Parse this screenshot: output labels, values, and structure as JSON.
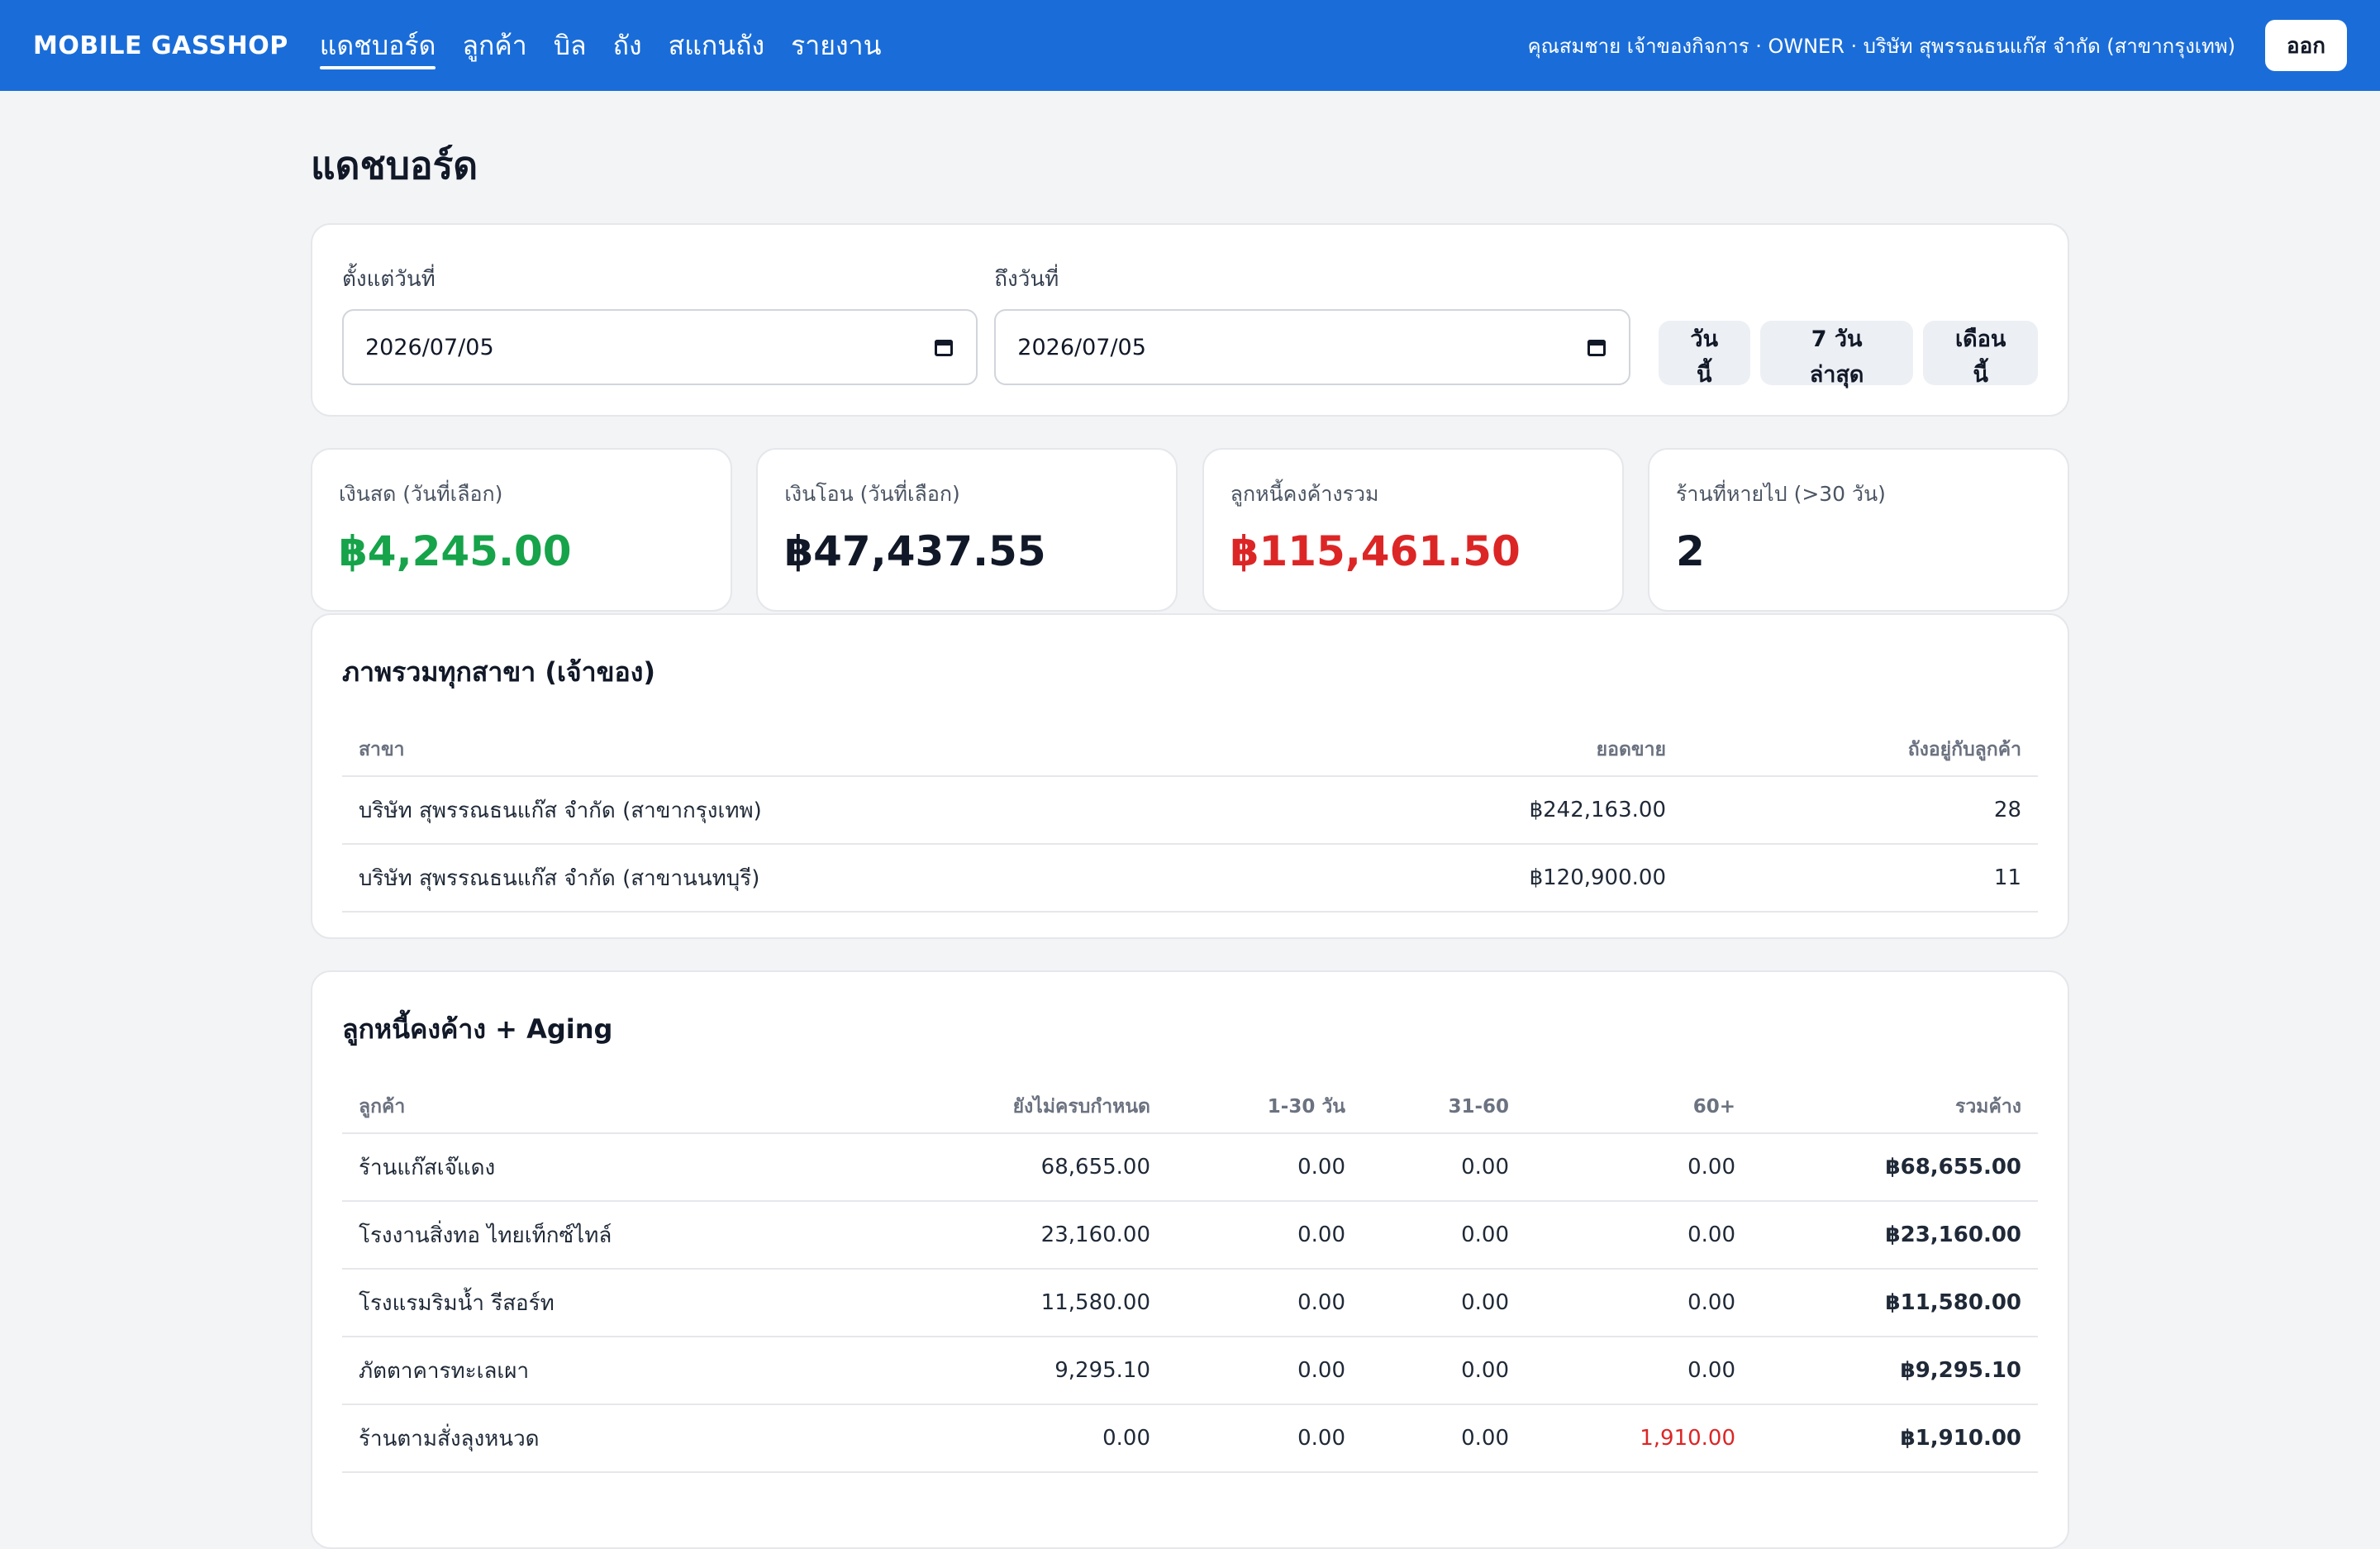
{
  "nav": {
    "brand": "MOBILE GASSHOP",
    "items": [
      {
        "label": "แดชบอร์ด",
        "active": true
      },
      {
        "label": "ลูกค้า"
      },
      {
        "label": "บิล"
      },
      {
        "label": "ถัง"
      },
      {
        "label": "สแกนถัง"
      },
      {
        "label": "รายงาน"
      }
    ],
    "user_info": "คุณสมชาย เจ้าของกิจการ · OWNER · บริษัท สุพรรณธนแก๊ส จำกัด (สาขากรุงเทพ)",
    "logout_label": "ออก"
  },
  "page_title": "แดชบอร์ด",
  "filter": {
    "from_label": "ตั้งแต่วันที่",
    "from_value": "2026/07/05",
    "to_label": "ถึงวันที่",
    "to_value": "2026/07/05",
    "quick": [
      "วันนี้",
      "7 วันล่าสุด",
      "เดือนนี้"
    ]
  },
  "stats": [
    {
      "label": "เงินสด (วันที่เลือก)",
      "value": "฿4,245.00",
      "color": "#16a34a"
    },
    {
      "label": "เงินโอน (วันที่เลือก)",
      "value": "฿47,437.55",
      "color": "#111827"
    },
    {
      "label": "ลูกหนี้คงค้างรวม",
      "value": "฿115,461.50",
      "color": "#dc2626"
    },
    {
      "label": "ร้านที่หายไป (>30 วัน)",
      "value": "2",
      "color": "#111827"
    }
  ],
  "branches": {
    "title": "ภาพรวมทุกสาขา (เจ้าของ)",
    "headers": [
      "สาขา",
      "ยอดขาย",
      "ถังอยู่กับลูกค้า"
    ],
    "rows": [
      [
        "บริษัท สุพรรณธนแก๊ส จำกัด (สาขากรุงเทพ)",
        "฿242,163.00",
        "28"
      ],
      [
        "บริษัท สุพรรณธนแก๊ส จำกัด (สาขานนทบุรี)",
        "฿120,900.00",
        "11"
      ]
    ]
  },
  "aging": {
    "title": "ลูกหนี้คงค้าง + Aging",
    "headers": [
      "ลูกค้า",
      "ยังไม่ครบกำหนด",
      "1-30 วัน",
      "31-60",
      "60+",
      "รวมค้าง"
    ],
    "rows": [
      [
        "ร้านแก๊สเจ๊แดง",
        "68,655.00",
        "0.00",
        "0.00",
        "0.00",
        "฿68,655.00"
      ],
      [
        "โรงงานสิ่งทอ ไทยเท็กซ์ไทล์",
        "23,160.00",
        "0.00",
        "0.00",
        "0.00",
        "฿23,160.00"
      ],
      [
        "โรงแรมริมน้ำ รีสอร์ท",
        "11,580.00",
        "0.00",
        "0.00",
        "0.00",
        "฿11,580.00"
      ],
      [
        "ภัตตาคารทะเลเผา",
        "9,295.10",
        "0.00",
        "0.00",
        "0.00",
        "฿9,295.10"
      ],
      [
        "ร้านตามสั่งลุงหนวด",
        "0.00",
        "0.00",
        "0.00",
        "1,910.00",
        "฿1,910.00"
      ]
    ]
  },
  "colors": {
    "topbar": "#1a6dd8",
    "positive": "#16a34a",
    "negative": "#dc2626"
  }
}
